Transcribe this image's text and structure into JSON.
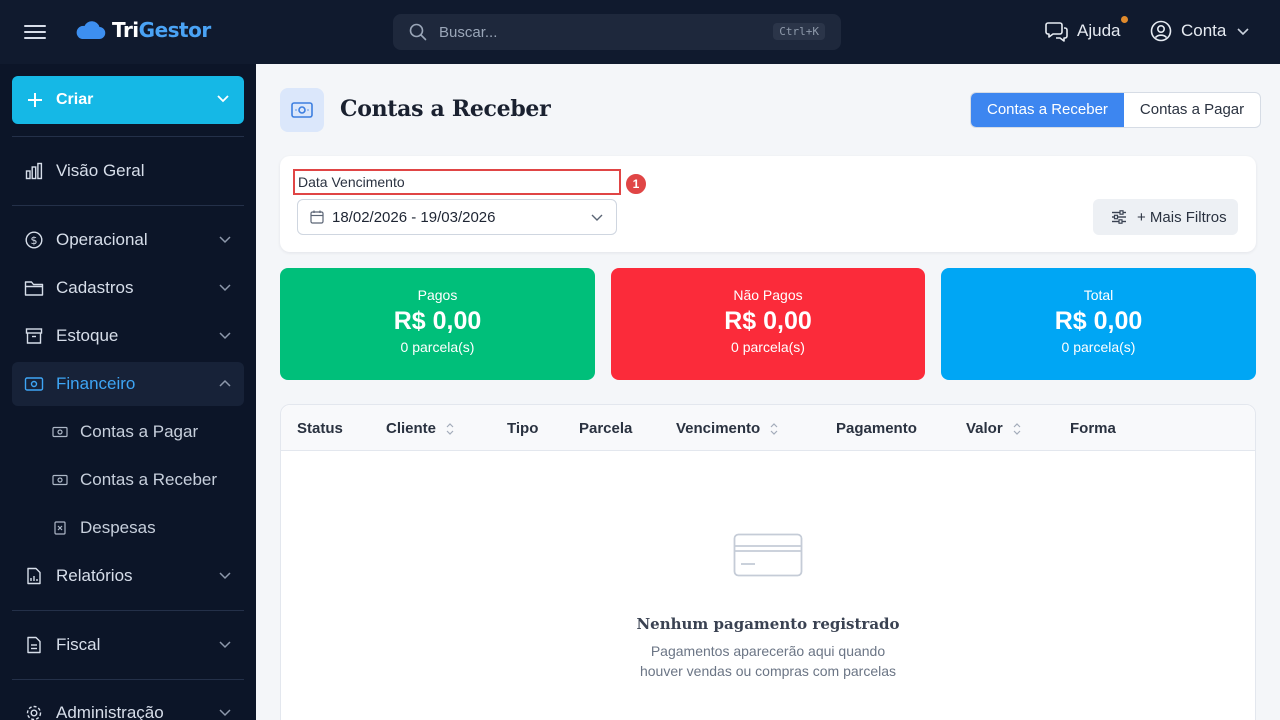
{
  "app": {
    "name_part1": "Tri",
    "name_part2": "Gestor"
  },
  "topbar": {
    "search_placeholder": "Buscar...",
    "search_shortcut": "Ctrl+K",
    "help_label": "Ajuda",
    "account_label": "Conta"
  },
  "sidebar": {
    "create_label": "Criar",
    "overview_label": "Visão Geral",
    "operational_label": "Operacional",
    "registers_label": "Cadastros",
    "stock_label": "Estoque",
    "financial_label": "Financeiro",
    "financial_sub": {
      "payables": "Contas a Pagar",
      "receivables": "Contas a Receber",
      "expenses": "Despesas"
    },
    "reports_label": "Relatórios",
    "fiscal_label": "Fiscal",
    "admin_label": "Administração"
  },
  "page": {
    "title": "Contas a Receber",
    "toggle_receivables": "Contas a Receber",
    "toggle_payables": "Contas a Pagar"
  },
  "filters": {
    "date_label": "Data Vencimento",
    "badge": "1",
    "date_range": "18/02/2026 - 19/03/2026",
    "more_filters": "+ Mais Filtros"
  },
  "stats": {
    "paid": {
      "label": "Pagos",
      "amount": "R$ 0,00",
      "count": "0 parcela(s)",
      "color": "#00bf7a"
    },
    "unpaid": {
      "label": "Não Pagos",
      "amount": "R$ 0,00",
      "count": "0 parcela(s)",
      "color": "#fb2b3a"
    },
    "total": {
      "label": "Total",
      "amount": "R$ 0,00",
      "count": "0 parcela(s)",
      "color": "#00a6f4"
    }
  },
  "table": {
    "columns": {
      "status": "Status",
      "client": "Cliente",
      "type": "Tipo",
      "installment": "Parcela",
      "due": "Vencimento",
      "payment": "Pagamento",
      "value": "Valor",
      "method": "Forma"
    },
    "empty_title": "Nenhum pagamento registrado",
    "empty_line1": "Pagamentos aparecerão aqui quando",
    "empty_line2": "houver vendas ou compras com parcelas"
  }
}
